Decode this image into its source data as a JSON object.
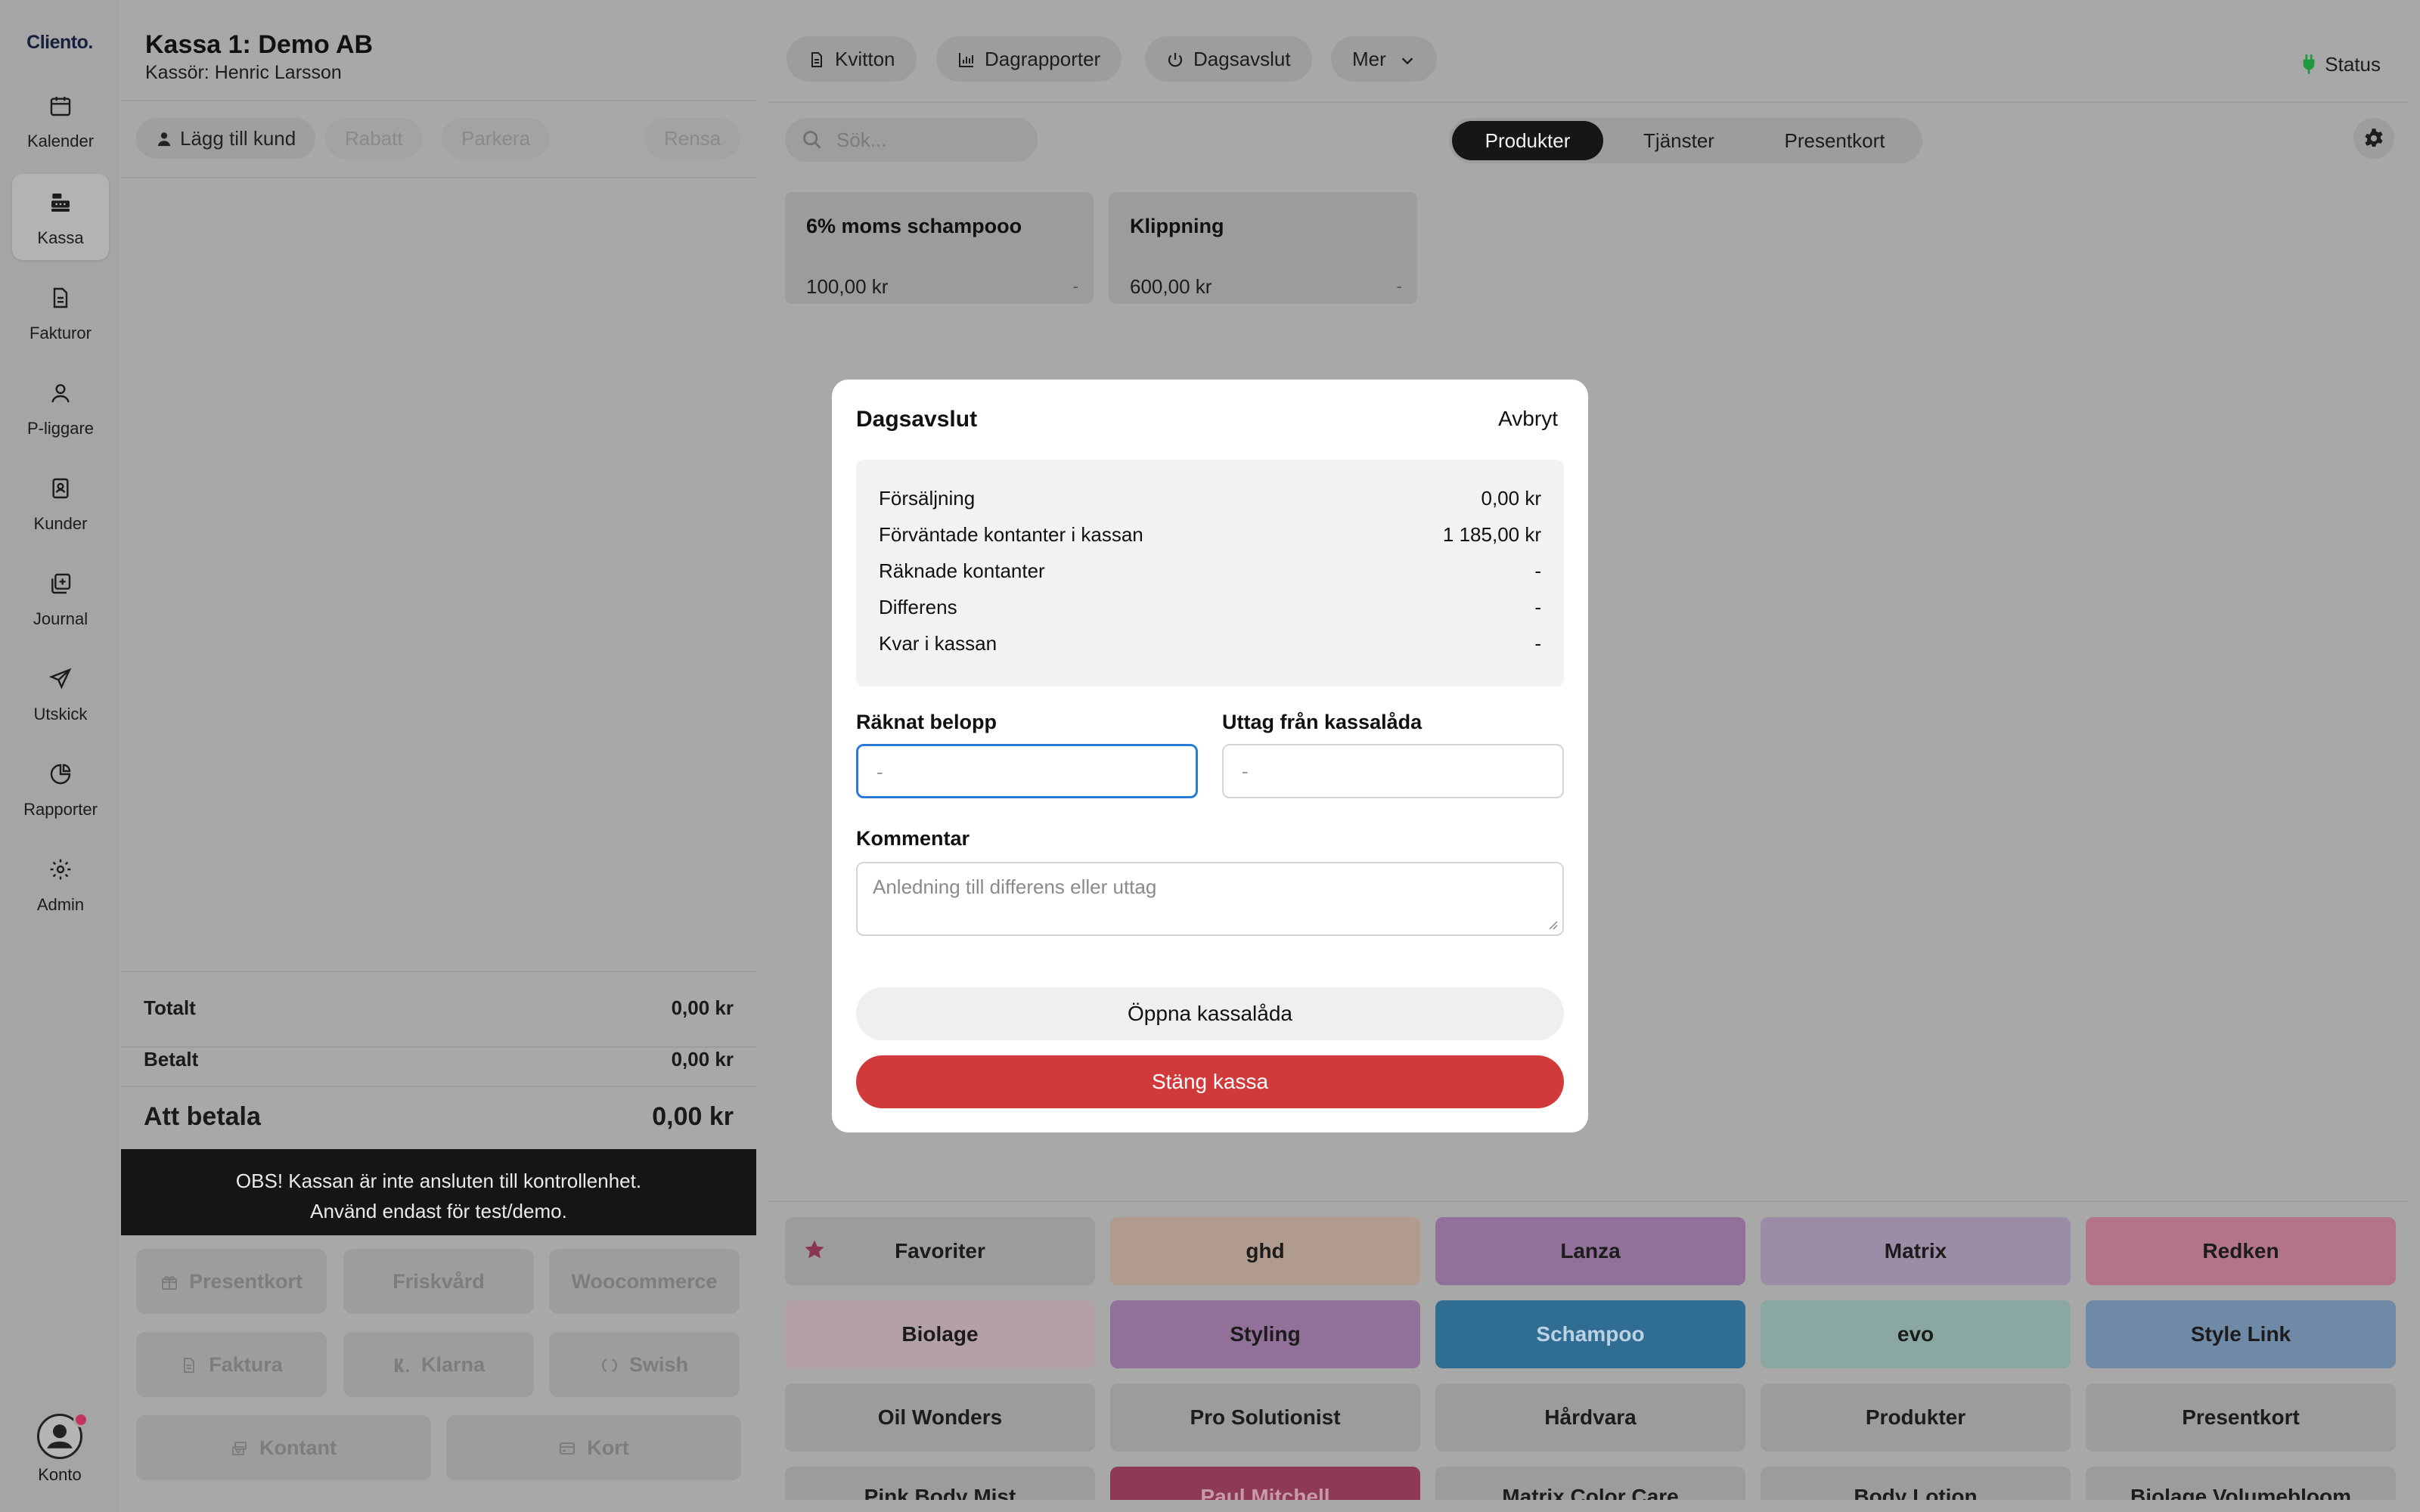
{
  "brand": {
    "logo_text": "Cliento."
  },
  "sidebar": {
    "items": [
      {
        "label": "Kalender",
        "icon": "calendar-icon"
      },
      {
        "label": "Kassa",
        "icon": "register-icon",
        "active": true
      },
      {
        "label": "Fakturor",
        "icon": "document-icon"
      },
      {
        "label": "P-liggare",
        "icon": "person-icon"
      },
      {
        "label": "Kunder",
        "icon": "contacts-icon"
      },
      {
        "label": "Journal",
        "icon": "journal-icon"
      },
      {
        "label": "Utskick",
        "icon": "send-icon"
      },
      {
        "label": "Rapporter",
        "icon": "pie-chart-icon"
      },
      {
        "label": "Admin",
        "icon": "gear-icon"
      }
    ],
    "account_label": "Konto"
  },
  "cart": {
    "title": "Kassa 1: Demo AB",
    "cashier": "Kassör: Henric Larsson",
    "add_customer": "Lägg till kund",
    "discount": "Rabatt",
    "park": "Parkera",
    "clear": "Rensa",
    "total_label": "Totalt",
    "total_value": "0,00 kr",
    "paid_label": "Betalt",
    "paid_value": "0,00 kr",
    "due_label": "Att betala",
    "due_value": "0,00 kr",
    "warning_line1": "OBS! Kassan är inte ansluten till kontrollenhet.",
    "warning_line2": "Använd endast för test/demo.",
    "payment_methods": {
      "giftcard": "Presentkort",
      "wellness": "Friskvård",
      "woocommerce": "Woocommerce",
      "invoice": "Faktura",
      "klarna": "Klarna",
      "swish": "Swish",
      "cash": "Kontant",
      "card": "Kort"
    }
  },
  "toolbar": {
    "receipts": "Kvitton",
    "day_reports": "Dagrapporter",
    "day_close": "Dagsavslut",
    "more": "Mer",
    "status": "Status",
    "status_color": "#1f9a3f"
  },
  "search": {
    "placeholder": "Sök..."
  },
  "tabs": {
    "products": "Produkter",
    "services": "Tjänster",
    "giftcards": "Presentkort"
  },
  "products": [
    {
      "name": "6% moms schampooo",
      "price": "100,00 kr",
      "extra": "-"
    },
    {
      "name": "Klippning",
      "price": "600,00 kr",
      "extra": "-"
    }
  ],
  "categories": [
    {
      "label": "Favoriter",
      "color": "#9c9c9c",
      "icon": "star-icon"
    },
    {
      "label": "ghd",
      "color": "#b19b8e"
    },
    {
      "label": "Lanza",
      "color": "#91709a"
    },
    {
      "label": "Matrix",
      "color": "#9d8ca7"
    },
    {
      "label": "Redken",
      "color": "#b2738b"
    },
    {
      "label": "Biolage",
      "color": "#b4a0a7"
    },
    {
      "label": "Styling",
      "color": "#91709a"
    },
    {
      "label": "Schampoo",
      "color": "#2f6d93"
    },
    {
      "label": "evo",
      "color": "#8aa7a2"
    },
    {
      "label": "Style Link",
      "color": "#6f8aa6"
    },
    {
      "label": "Oil Wonders",
      "color": "#9c9c9c"
    },
    {
      "label": "Pro Solutionist",
      "color": "#9c9c9c"
    },
    {
      "label": "Hårdvara",
      "color": "#9c9c9c"
    },
    {
      "label": "Produkter",
      "color": "#9c9c9c"
    },
    {
      "label": "Presentkort",
      "color": "#9c9c9c"
    },
    {
      "label": "Pink Body Mist",
      "color": "#9c9c9c"
    },
    {
      "label": "Paul Mitchell",
      "color": "#8f3a55"
    },
    {
      "label": "Matrix Color Care",
      "color": "#9c9c9c"
    },
    {
      "label": "Body Lotion",
      "color": "#9c9c9c"
    },
    {
      "label": "Biolage Volumebloom",
      "color": "#9c9c9c"
    }
  ],
  "modal": {
    "title": "Dagsavslut",
    "cancel": "Avbryt",
    "summary": [
      {
        "label": "Försäljning",
        "value": "0,00 kr"
      },
      {
        "label": "Förväntade kontanter i kassan",
        "value": "1 185,00 kr"
      },
      {
        "label": "Räknade kontanter",
        "value": "-"
      },
      {
        "label": "Differens",
        "value": "-"
      },
      {
        "label": "Kvar i kassan",
        "value": "-"
      }
    ],
    "counted_label": "Räknat belopp",
    "counted_placeholder": "-",
    "withdraw_label": "Uttag från kassalåda",
    "withdraw_placeholder": "-",
    "comment_label": "Kommentar",
    "comment_placeholder": "Anledning till differens eller uttag",
    "open_drawer": "Öppna kassalåda",
    "close_register": "Stäng kassa",
    "close_color": "#d13a3b"
  }
}
